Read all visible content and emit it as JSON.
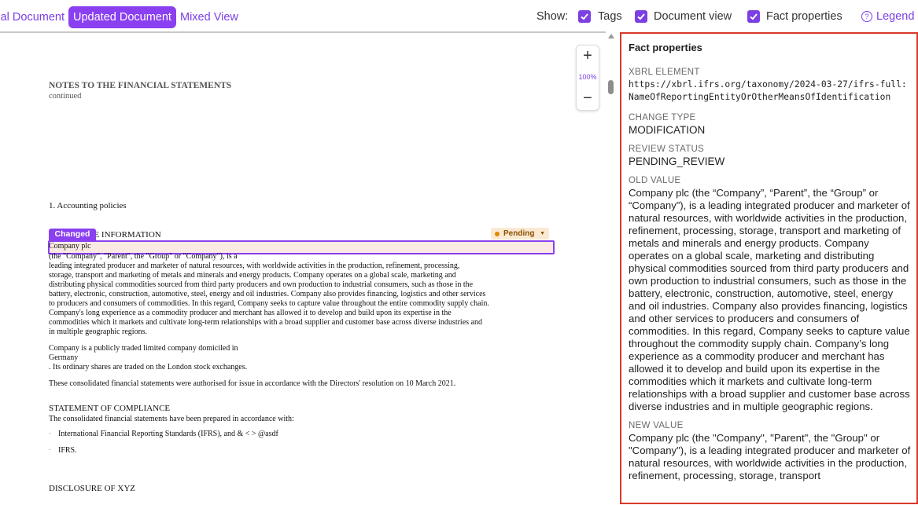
{
  "toolbar": {
    "tabs": [
      {
        "label": "Original Document"
      },
      {
        "label": "Updated Document"
      },
      {
        "label": "Mixed View"
      }
    ],
    "show_label": "Show:",
    "toggles": [
      {
        "label": "Tags",
        "checked": true
      },
      {
        "label": "Document view",
        "checked": true
      },
      {
        "label": "Fact properties",
        "checked": true
      }
    ],
    "legend_label": "Legend",
    "accent_color": "#8a3ff0"
  },
  "document": {
    "heading": "NOTES TO THE FINANCIAL STATEMENTS",
    "subheading": "continued",
    "section1": "1. Accounting policies",
    "corporate_info_heading": "CORPORATE INFORMATION",
    "changed_tag": "Changed",
    "pending_tag": "Pending",
    "highlighted_text": "Company plc",
    "para1_lines": [
      "(the \"Company\", \"Parent\", the \"Group\" or \"Company\"), is a",
      "leading integrated producer and marketer of natural resources, with worldwide activities in the production, refinement, processing,",
      "storage, transport and marketing of metals and minerals and energy products. Company operates on a global scale, marketing and",
      "distributing physical commodities sourced from third party producers and own production to industrial consumers, such as those in the",
      "battery, electronic, construction, automotive, steel, energy and oil industries. Company also provides financing, logistics and other services",
      "to producers and consumers of commodities. In this regard, Company seeks to capture value throughout the entire commodity supply chain.",
      "Company's long experience as a commodity producer and merchant has allowed it to develop and build upon its expertise in the",
      "commodities which it markets and cultivate long-term relationships with a broad supplier and customer base across diverse industries and",
      "in multiple geographic regions."
    ],
    "para2_lines": [
      "Company is a publicly traded limited company domiciled in",
      "Germany",
      ". Its ordinary shares are traded on the London stock exchanges."
    ],
    "para3": "These consolidated financial statements were authorised for issue in accordance with the Directors' resolution on 10 March 2021.",
    "compliance_heading": "STATEMENT OF COMPLIANCE",
    "compliance_intro": "The consolidated financial statements have been prepared in accordance with:",
    "bullets": [
      "International Financial Reporting Standards (IFRS), and & < > @asdf",
      "IFRS."
    ],
    "disclosure_heading": "DISCLOSURE OF XYZ",
    "zoom_level": "100%"
  },
  "facts": {
    "title": "Fact properties",
    "xbrl_label": "XBRL ELEMENT",
    "xbrl_value": "https://xbrl.ifrs.org/taxonomy/2024-03-27/ifrs-full:NameOfReportingEntityOrOtherMeansOfIdentification",
    "change_type_label": "CHANGE TYPE",
    "change_type_value": "MODIFICATION",
    "review_status_label": "REVIEW STATUS",
    "review_status_value": "PENDING_REVIEW",
    "old_value_label": "OLD VALUE",
    "old_value": "Company plc (the “Company”, “Parent”, the “Group” or “Company”), is a leading integrated producer and marketer of natural resources, with worldwide activities in the production, refinement, processing, storage, transport and marketing of metals and minerals and energy products. Company operates on a global scale, marketing and distributing physical commodities sourced from third party producers and own production to industrial consumers, such as those in the battery, electronic, construction, automotive, steel, energy and oil industries. Company also provides financing, logistics and other services to producers and consumers of commodities. In this regard, Company seeks to capture value throughout the commodity supply chain. Company’s long experience as a commodity producer and merchant has allowed it to develop and build upon its expertise in the commodities which it markets and cultivate long-term relationships with a broad supplier and customer base across diverse industries and in multiple geographic regions.",
    "new_value_label": "NEW VALUE",
    "new_value": "Company plc (the \"Company\", \"Parent\", the \"Group\" or \"Company\"), is a leading integrated producer and marketer of natural resources, with worldwide activities in the production, refinement, processing, storage, transport"
  }
}
